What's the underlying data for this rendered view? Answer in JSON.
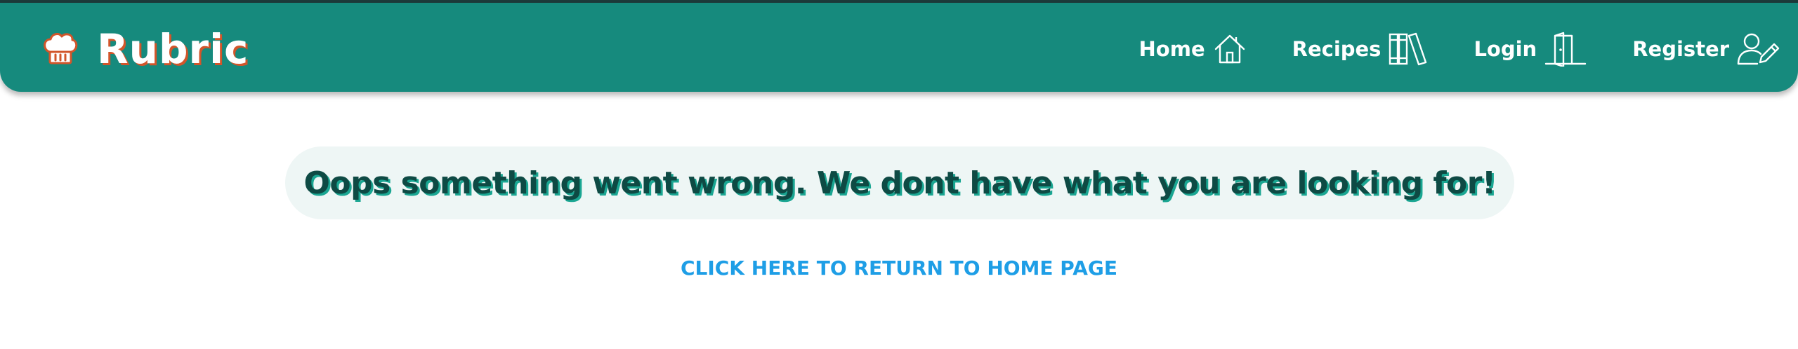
{
  "brand": {
    "name": "Rubric",
    "icon": "chef-hat-icon"
  },
  "nav": {
    "items": [
      {
        "label": "Home",
        "icon": "house-icon"
      },
      {
        "label": "Recipes",
        "icon": "books-icon"
      },
      {
        "label": "Login",
        "icon": "door-icon"
      },
      {
        "label": "Register",
        "icon": "user-edit-icon"
      }
    ]
  },
  "error": {
    "message": "Oops something went wrong. We dont have what you are looking for!"
  },
  "home_link": {
    "label": "CLICK HERE TO RETURN TO HOME PAGE"
  },
  "colors": {
    "navbar": "#168a7d",
    "brand_shadow": "#d2552a",
    "error_text": "#0e4a44",
    "error_shadow": "#1aa692",
    "link": "#1e9ee6"
  }
}
